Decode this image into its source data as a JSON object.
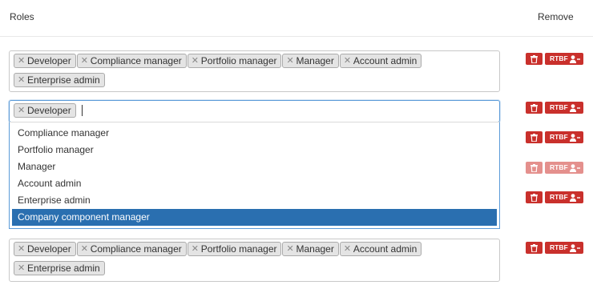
{
  "header": {
    "roles_label": "Roles",
    "remove_label": "Remove"
  },
  "rows": [
    {
      "tags": [
        "Developer",
        "Compliance manager",
        "Portfolio manager",
        "Manager",
        "Account admin",
        "Enterprise admin"
      ]
    },
    {
      "tags": [
        "Developer"
      ]
    },
    {
      "tags": [
        "Developer",
        "Compliance manager",
        "Portfolio manager",
        "Manager",
        "Account admin",
        "Enterprise admin"
      ]
    }
  ],
  "dropdown": {
    "options": [
      "Compliance manager",
      "Portfolio manager",
      "Manager",
      "Account admin",
      "Enterprise admin",
      "Company component manager"
    ],
    "highlighted_index": 5
  },
  "remove_buttons": {
    "rtbf_label": "RTBF",
    "delete_icon": "trash-icon",
    "rtbf_icon": "user-remove-icon",
    "disabled_row_index": 3,
    "count": 6
  },
  "colors": {
    "danger": "#c9302c",
    "danger_disabled": "#e4908d",
    "highlight": "#2a6fb0",
    "focus_border": "#5b9bd8"
  }
}
